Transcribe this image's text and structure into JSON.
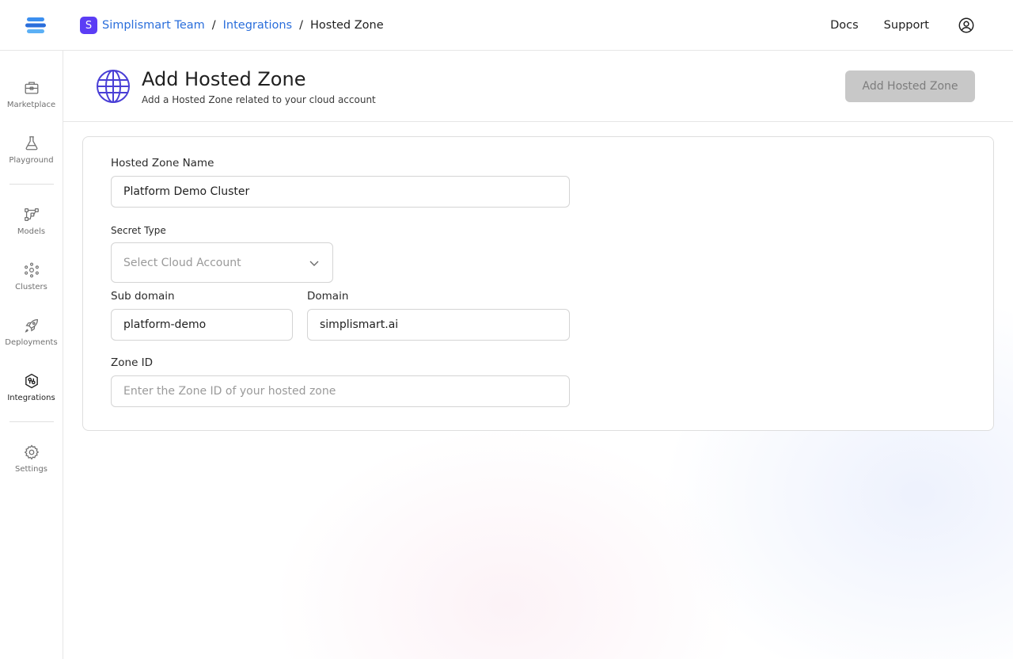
{
  "breadcrumb": {
    "team_initial": "S",
    "team": "Simplismart Team",
    "section": "Integrations",
    "current": "Hosted Zone",
    "separator": "/"
  },
  "top_links": {
    "docs": "Docs",
    "support": "Support"
  },
  "sidebar": {
    "items": [
      {
        "label": "Marketplace",
        "icon": "marketplace-icon"
      },
      {
        "label": "Playground",
        "icon": "flask-icon"
      },
      {
        "label": "Models",
        "icon": "models-icon"
      },
      {
        "label": "Clusters",
        "icon": "clusters-icon"
      },
      {
        "label": "Deployments",
        "icon": "rocket-icon"
      },
      {
        "label": "Integrations",
        "icon": "integrations-icon",
        "active": true
      },
      {
        "label": "Settings",
        "icon": "gear-icon"
      }
    ]
  },
  "header": {
    "title": "Add Hosted Zone",
    "subtitle": "Add a Hosted Zone related to your cloud account",
    "button_label": "Add Hosted Zone"
  },
  "form": {
    "hosted_zone_name": {
      "label": "Hosted Zone Name",
      "value": "Platform Demo Cluster"
    },
    "secret_type": {
      "label": "Secret Type",
      "placeholder": "Select Cloud Account"
    },
    "sub_domain": {
      "label": "Sub domain",
      "value": "platform-demo"
    },
    "domain": {
      "label": "Domain",
      "value": "simplismart.ai"
    },
    "zone_id": {
      "label": "Zone ID",
      "placeholder": "Enter the Zone ID of your hosted zone"
    }
  },
  "colors": {
    "accent": "#5b3df5",
    "link": "#2a6edb",
    "disabled_button": "#c8c8c8",
    "globe": "#4a3fd6"
  }
}
